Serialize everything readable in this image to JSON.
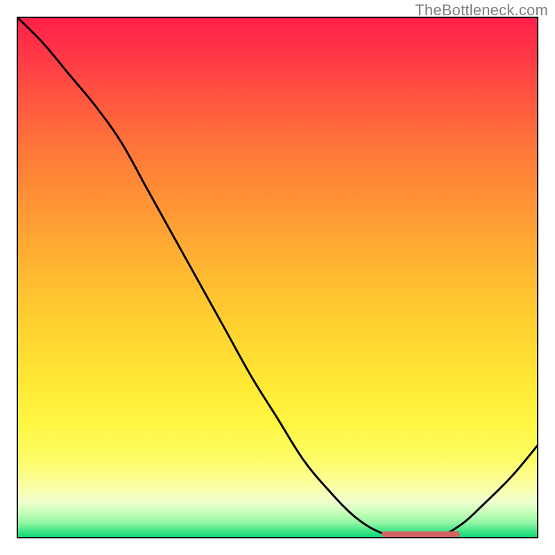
{
  "watermark": "TheBottleneck.com",
  "chart_data": {
    "type": "line",
    "title": "",
    "xlabel": "",
    "ylabel": "",
    "xlim": [
      0,
      100
    ],
    "ylim": [
      0,
      100
    ],
    "grid": false,
    "series": [
      {
        "name": "curve",
        "color": "#000000",
        "x": [
          0,
          5,
          10,
          15,
          20,
          25,
          30,
          35,
          40,
          45,
          50,
          55,
          60,
          65,
          70,
          75,
          80,
          85,
          90,
          95,
          100
        ],
        "values": [
          100,
          95,
          89,
          83,
          76,
          67,
          58,
          49,
          40,
          31,
          23,
          15,
          9,
          4,
          1,
          0,
          0,
          2.5,
          7,
          12,
          18
        ]
      }
    ],
    "marker": {
      "x_start": 70,
      "x_end": 85,
      "y": 0,
      "color": "#d46262"
    },
    "background_gradient": {
      "type": "vertical",
      "stops": [
        {
          "pos": 0.0,
          "color": "#ff1f4a"
        },
        {
          "pos": 0.15,
          "color": "#ff5340"
        },
        {
          "pos": 0.38,
          "color": "#ff9a34"
        },
        {
          "pos": 0.6,
          "color": "#ffd330"
        },
        {
          "pos": 0.78,
          "color": "#fff642"
        },
        {
          "pos": 0.9,
          "color": "#fbfea3"
        },
        {
          "pos": 0.95,
          "color": "#c8feba"
        },
        {
          "pos": 1.0,
          "color": "#02d66e"
        }
      ]
    }
  }
}
